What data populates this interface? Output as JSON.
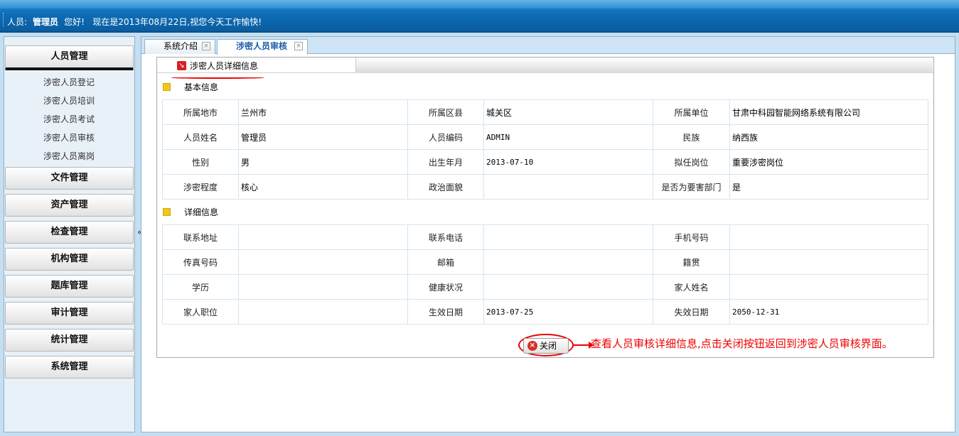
{
  "header": {
    "person_label": "人员:",
    "user_name": "管理员",
    "greeting": "您好!",
    "date_message": "现在是2013年08月22日,视您今天工作愉快!"
  },
  "sidebar": {
    "groups": [
      {
        "label": "人员管理",
        "active": true,
        "items": [
          "涉密人员登记",
          "涉密人员培训",
          "涉密人员考试",
          "涉密人员审核",
          "涉密人员离岗"
        ]
      },
      {
        "label": "文件管理"
      },
      {
        "label": "资产管理"
      },
      {
        "label": "检查管理"
      },
      {
        "label": "机构管理"
      },
      {
        "label": "题库管理"
      },
      {
        "label": "审计管理"
      },
      {
        "label": "统计管理"
      },
      {
        "label": "系统管理"
      }
    ],
    "collapse_glyph": "«"
  },
  "tabs": [
    {
      "label": "系统介绍",
      "close": "×"
    },
    {
      "label": "涉密人员审核",
      "close": "×",
      "active": true
    }
  ],
  "subtab": {
    "label": "涉密人员详细信息",
    "icon": "arrow-icon"
  },
  "basic_info": {
    "title": "基本信息",
    "rows": [
      [
        {
          "label": "所属地市",
          "value": "兰州市"
        },
        {
          "label": "所属区县",
          "value": "城关区"
        },
        {
          "label": "所属单位",
          "value": "甘肃中科园智能网络系统有限公司"
        }
      ],
      [
        {
          "label": "人员姓名",
          "value": "管理员"
        },
        {
          "label": "人员编码",
          "value": "ADMIN"
        },
        {
          "label": "民族",
          "value": "纳西族"
        }
      ],
      [
        {
          "label": "性别",
          "value": "男"
        },
        {
          "label": "出生年月",
          "value": "2013-07-10"
        },
        {
          "label": "拟任岗位",
          "value": "重要涉密岗位"
        }
      ],
      [
        {
          "label": "涉密程度",
          "value": "核心"
        },
        {
          "label": "政治面貌",
          "value": ""
        },
        {
          "label": "是否为要害部门",
          "value": "是"
        }
      ]
    ]
  },
  "detail_info": {
    "title": "详细信息",
    "rows": [
      [
        {
          "label": "联系地址",
          "value": ""
        },
        {
          "label": "联系电话",
          "value": ""
        },
        {
          "label": "手机号码",
          "value": ""
        }
      ],
      [
        {
          "label": "传真号码",
          "value": ""
        },
        {
          "label": "邮箱",
          "value": ""
        },
        {
          "label": "籍贯",
          "value": ""
        }
      ],
      [
        {
          "label": "学历",
          "value": ""
        },
        {
          "label": "健康状况",
          "value": ""
        },
        {
          "label": "家人姓名",
          "value": ""
        }
      ],
      [
        {
          "label": "家人职位",
          "value": ""
        },
        {
          "label": "生效日期",
          "value": "2013-07-25"
        },
        {
          "label": "失效日期",
          "value": "2050-12-31"
        }
      ]
    ]
  },
  "close_button": {
    "label": "关闭",
    "icon_glyph": "×"
  },
  "annotation": "查看人员审核详细信息,点击关闭按钮返回到涉密人员审核界面。",
  "colors": {
    "accent_red": "#ee0000",
    "header_blue": "#0e6db6",
    "bullet_yellow": "#f3c61d"
  }
}
